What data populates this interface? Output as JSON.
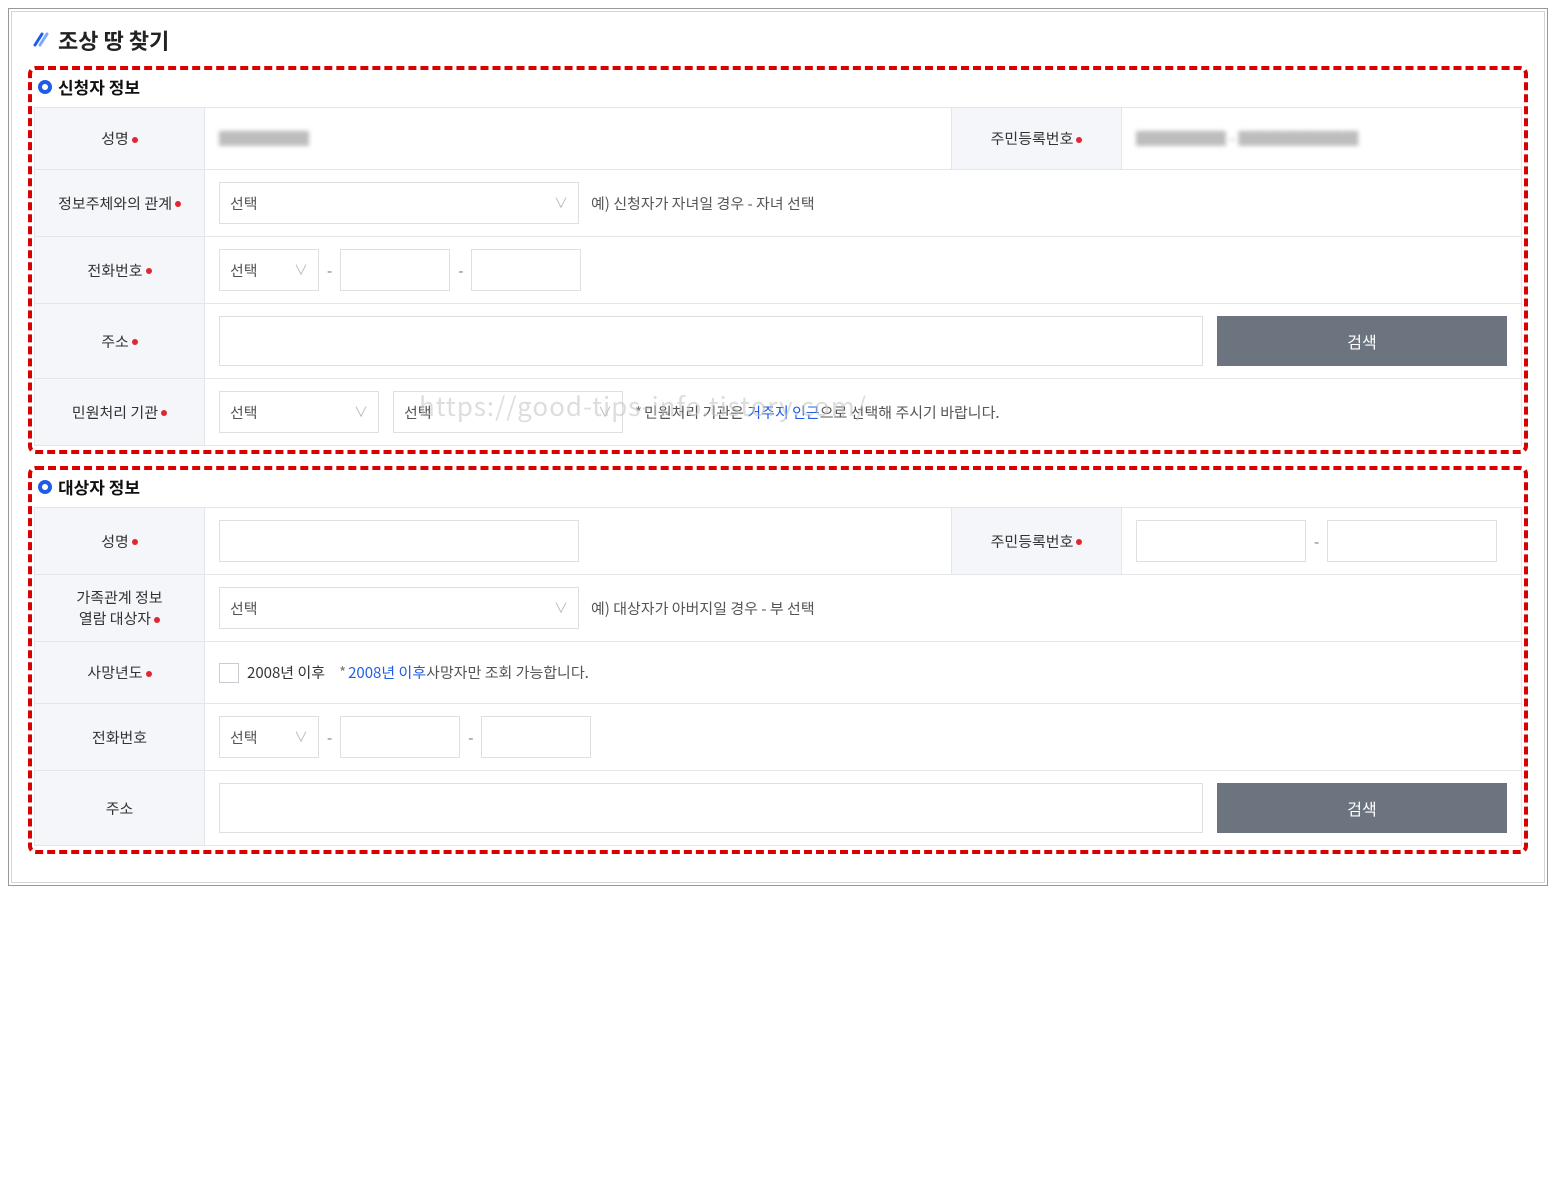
{
  "page": {
    "title": "조상 땅 찾기"
  },
  "watermark": "https://good-tips-info.tistory.com/",
  "common": {
    "select_placeholder": "선택",
    "search_btn": "검색",
    "dash": "-"
  },
  "applicant": {
    "section_title": "신청자 정보",
    "labels": {
      "name": "성명",
      "rrn": "주민등록번호",
      "relation": "정보주체와의 관계",
      "phone": "전화번호",
      "address": "주소",
      "agency": "민원처리 기관"
    },
    "name_value": "██████",
    "rrn_value": "██████ - ████████",
    "relation_hint": "예) 신청자가 자녀일 경우 - 자녀 선택",
    "agency_hint_prefix": "민원처리 기관은 ",
    "agency_hint_blue": "거주지 인근",
    "agency_hint_suffix": "으로 선택해 주시기 바랍니다."
  },
  "subject": {
    "section_title": "대상자 정보",
    "labels": {
      "name": "성명",
      "rrn": "주민등록번호",
      "family_relation": "가족관계 정보 열람 대상자",
      "family_relation_line1": "가족관계 정보",
      "family_relation_line2": "열람 대상자",
      "death_year": "사망년도",
      "phone": "전화번호",
      "address": "주소"
    },
    "relation_hint": "예) 대상자가 아버지일 경우 - 부 선택",
    "death_checkbox_label": "2008년 이후",
    "death_star": "*",
    "death_hint_blue": "2008년 이후",
    "death_hint_suffix": "사망자만 조회 가능합니다."
  }
}
